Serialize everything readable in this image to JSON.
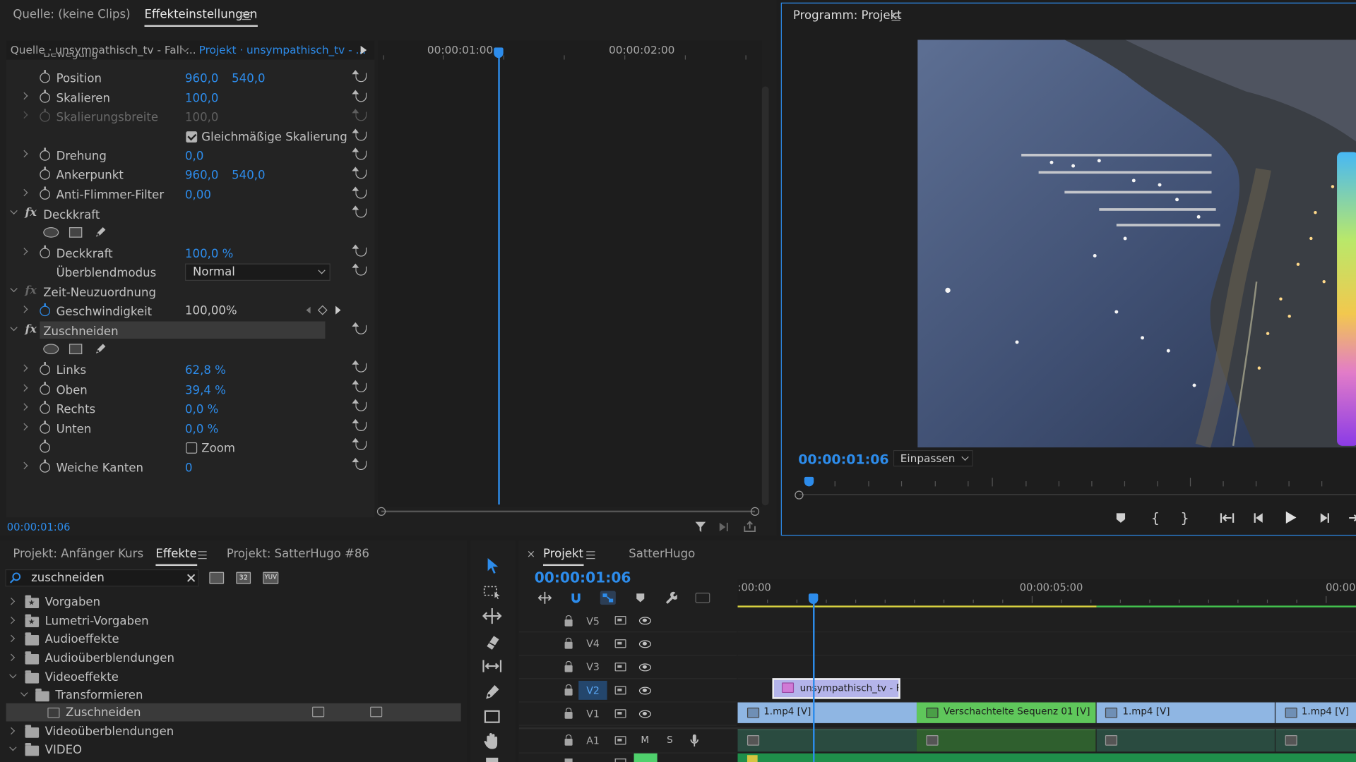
{
  "source_panel": {
    "tab_source": "Quelle: (keine Clips)",
    "tab_effects": "Effekteinstellungen",
    "breadcrumb_source": "Quelle · unsympathisch_tv - Fall ...",
    "breadcrumb_project": "Projekt · unsympathisch_tv - ...",
    "timecode_1": "00:00:01:00",
    "timecode_2": "00:00:02:00",
    "footer_timecode": "00:00:01:06"
  },
  "effects": {
    "cut_heading": "Bewegung",
    "position_label": "Position",
    "position_x": "960,0",
    "position_y": "540,0",
    "scale_label": "Skalieren",
    "scale_value": "100,0",
    "scale_width_label": "Skalierungsbreite",
    "scale_width_value": "100,0",
    "uniform_scale_label": "Gleichmäßige Skalierung",
    "rotation_label": "Drehung",
    "rotation_value": "0,0",
    "anchor_label": "Ankerpunkt",
    "anchor_x": "960,0",
    "anchor_y": "540,0",
    "antiflicker_label": "Anti-Flimmer-Filter",
    "antiflicker_value": "0,00",
    "opacity_group": "Deckkraft",
    "opacity_label": "Deckkraft",
    "opacity_value": "100,0 %",
    "blend_label": "Überblendmodus",
    "blend_value": "Normal",
    "time_remap_group": "Zeit-Neuzuordnung",
    "speed_label": "Geschwindigkeit",
    "speed_value": "100,00%",
    "crop_group": "Zuschneiden",
    "left_label": "Links",
    "left_value": "62,8 %",
    "top_label": "Oben",
    "top_value": "39,4 %",
    "right_label": "Rechts",
    "right_value": "0,0 %",
    "bottom_label": "Unten",
    "bottom_value": "0,0 %",
    "zoom_label": "Zoom",
    "feather_label": "Weiche Kanten",
    "feather_value": "0"
  },
  "program_panel": {
    "title": "Programm: Projekt",
    "timecode": "00:00:01:06",
    "fit_label": "Einpassen"
  },
  "effects_browser": {
    "tab_project_a": "Projekt: Anfänger Kurs",
    "tab_effects": "Effekte",
    "tab_project_b": "Projekt: SatterHugo #86",
    "search_value": "zuschneiden",
    "badge_32": "32",
    "badge_yuv": "YUV",
    "items": [
      {
        "label": "Vorgaben"
      },
      {
        "label": "Lumetri-Vorgaben"
      },
      {
        "label": "Audioeffekte"
      },
      {
        "label": "Audioüberblendungen"
      },
      {
        "label": "Videoeffekte"
      },
      {
        "label": "Transformieren"
      },
      {
        "label": "Zuschneiden"
      },
      {
        "label": "Videoüberblendungen"
      },
      {
        "label": "VIDEO"
      }
    ]
  },
  "timeline": {
    "tab_project": "Projekt",
    "tab_satter": "SatterHugo",
    "timecode": "00:00:01:06",
    "ruler_start": ":00:00",
    "ruler_mid": "00:00:05:00",
    "ruler_end": "00:00:",
    "tracks": [
      "V5",
      "V4",
      "V3",
      "V2",
      "V1",
      "A1"
    ],
    "mute": "M",
    "solo": "S",
    "clips": {
      "v2": "unsympathisch_tv - Fall",
      "v1_a": "1.mp4 [V]",
      "v1_b": "Verschachtelte Sequenz 01 [V]",
      "v1_c": "1.mp4 [V]",
      "v1_d": "1.mp4 [V]"
    }
  },
  "colors": {
    "accent_blue": "#2d8ceb",
    "clip_blue": "#8fb6e3",
    "clip_green": "#5fc75b",
    "clip_violet": "#b4b4ea"
  }
}
